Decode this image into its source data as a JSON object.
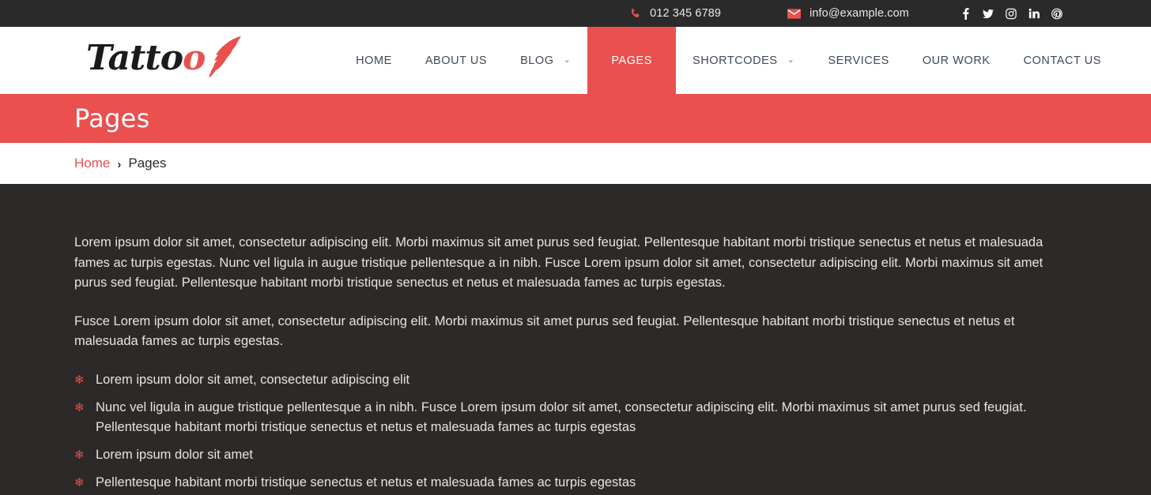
{
  "topbar": {
    "phone": {
      "icon": "phone-icon",
      "text": "012 345 6789"
    },
    "email": {
      "icon": "envelope-icon",
      "text": "info@example.com"
    },
    "social": [
      {
        "name": "facebook-icon",
        "label": "Facebook"
      },
      {
        "name": "twitter-icon",
        "label": "Twitter"
      },
      {
        "name": "instagram-icon",
        "label": "Instagram"
      },
      {
        "name": "linkedin-icon",
        "label": "LinkedIn"
      },
      {
        "name": "pinterest-icon",
        "label": "Pinterest"
      }
    ]
  },
  "header": {
    "logo": {
      "text_dark": "Tatto",
      "text_accent": "o",
      "full": "Tattoo"
    },
    "nav": [
      {
        "label": "HOME",
        "has_dropdown": false,
        "active": false
      },
      {
        "label": "ABOUT US",
        "has_dropdown": false,
        "active": false
      },
      {
        "label": "BLOG",
        "has_dropdown": true,
        "caret": "⌄",
        "active": false
      },
      {
        "label": "PAGES",
        "has_dropdown": false,
        "active": true
      },
      {
        "label": "SHORTCODES",
        "has_dropdown": true,
        "caret": "⌄",
        "active": false
      },
      {
        "label": "SERVICES",
        "has_dropdown": false,
        "active": false
      },
      {
        "label": "OUR WORK",
        "has_dropdown": false,
        "active": false
      },
      {
        "label": "CONTACT US",
        "has_dropdown": false,
        "active": false
      }
    ]
  },
  "banner": {
    "title": "Pages"
  },
  "breadcrumb": {
    "home": "Home",
    "separator": "›",
    "current": "Pages"
  },
  "main": {
    "paragraphs": [
      "Lorem ipsum dolor sit amet, consectetur adipiscing elit. Morbi maximus sit amet purus sed feugiat. Pellentesque habitant morbi tristique senectus et netus et malesuada fames ac turpis egestas. Nunc vel ligula in augue tristique pellentesque a in nibh. Fusce Lorem ipsum dolor sit amet, consectetur adipiscing elit. Morbi maximus sit amet purus sed feugiat. Pellentesque habitant morbi tristique senectus et netus et malesuada fames ac turpis egestas.",
      "Fusce Lorem ipsum dolor sit amet, consectetur adipiscing elit. Morbi maximus sit amet purus sed feugiat. Pellentesque habitant morbi tristique senectus et netus et malesuada fames ac turpis egestas."
    ],
    "bullet_glyph": "❄",
    "list_items": [
      "Lorem ipsum dolor sit amet, consectetur adipiscing elit",
      "Nunc vel ligula in augue tristique pellentesque a in nibh. Fusce Lorem ipsum dolor sit amet, consectetur adipiscing elit. Morbi maximus sit amet purus sed feugiat. Pellentesque habitant morbi tristique senectus et netus et malesuada fames ac turpis egestas",
      "Lorem ipsum dolor sit amet",
      "Pellentesque habitant morbi tristique senectus et netus et malesuada fames ac turpis egestas"
    ]
  },
  "colors": {
    "accent": "#e9504e",
    "topbar_bg": "#2a2a2a",
    "content_bg": "#2b2a28",
    "header_bg": "#ffffff",
    "nav_text": "#3e4a59",
    "body_text": "#e6e4e1"
  }
}
